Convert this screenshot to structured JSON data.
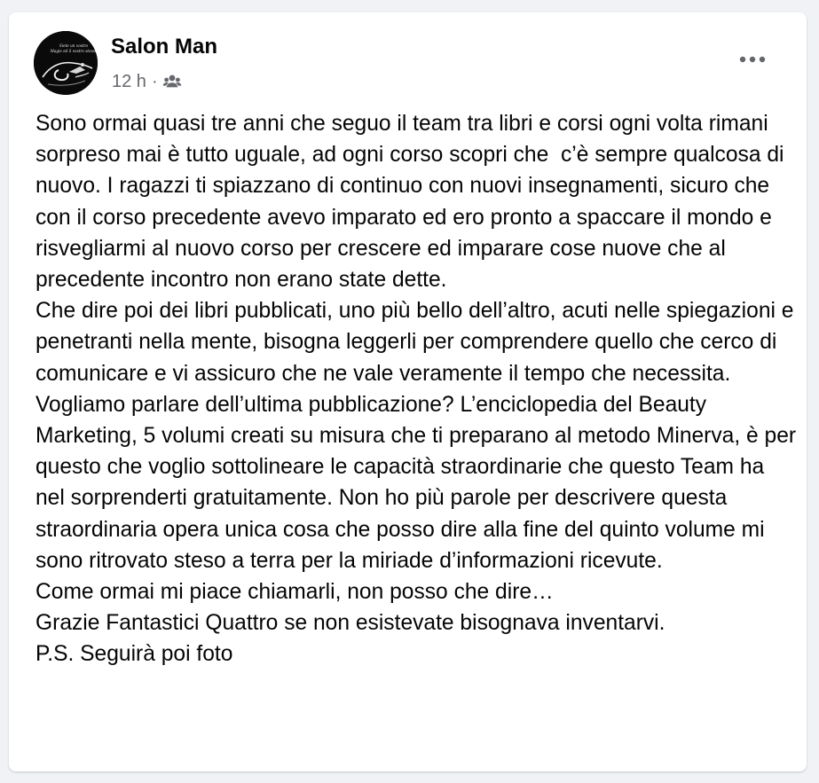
{
  "post": {
    "author": "Salon Man",
    "time": "12 h",
    "separator": "·",
    "audience_icon": "friends-icon",
    "more_icon": "more-options-icon",
    "avatar": {
      "line1": "Siete un vostro",
      "line2": "Magie ed il vostro stesso"
    },
    "paragraphs": [
      "Sono ormai quasi tre anni che seguo il team tra libri e corsi ogni volta rimani sorpreso mai è tutto uguale, ad ogni corso scopri che  c’è sempre qualcosa di nuovo. I ragazzi ti spiazzano di continuo con nuovi insegnamenti, sicuro che con il corso precedente avevo imparato ed ero pronto a spaccare il mondo e risvegliarmi al nuovo corso per crescere ed imparare cose nuove che al precedente incontro non erano state dette.",
      "Che dire poi dei libri pubblicati, uno più bello dell’altro, acuti nelle spiegazioni e penetranti nella mente, bisogna leggerli per comprendere quello che cerco di comunicare e vi assicuro che ne vale veramente il tempo che necessita.",
      "Vogliamo parlare dell’ultima pubblicazione? L’enciclopedia del Beauty Marketing, 5 volumi creati su misura che ti preparano al metodo Minerva, è per questo che voglio sottolineare le capacità straordinarie che questo Team ha nel sorprenderti gratuitamente. Non ho più parole per descrivere questa straordinaria opera unica cosa che posso dire alla fine del quinto volume mi sono ritrovato steso a terra per la miriade d’informazioni ricevute.",
      "Come ormai mi piace chiamarli, non posso che dire…",
      "Grazie Fantastici Quattro se non esistevate bisognava inventarvi.",
      "P.S. Seguirà poi foto"
    ]
  }
}
